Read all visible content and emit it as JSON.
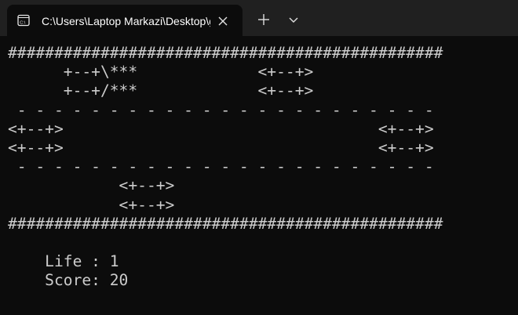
{
  "window": {
    "tab_title": "C:\\Users\\Laptop Markazi\\Desktop\\game.exe",
    "tab_icon": "terminal-icon",
    "close_icon": "close-icon",
    "new_tab_icon": "plus-icon",
    "dropdown_icon": "chevron-down-icon"
  },
  "terminal": {
    "lines": [
      "###############################################",
      "      +--+\\***             <+--+>",
      "      +--+/***             <+--+>",
      " - - - - - - - - - - - - - - - - - - - - - - -",
      "<+--+>                                  <+--+>",
      "<+--+>                                  <+--+>",
      " - - - - - - - - - - - - - - - - - - - - - - -",
      "            <+--+>",
      "            <+--+>",
      "###############################################",
      "",
      "    Life : 1",
      "    Score: 20"
    ]
  },
  "colors": {
    "background": "#0c0c0c",
    "titlebar": "#202020",
    "text": "#cccccc"
  }
}
